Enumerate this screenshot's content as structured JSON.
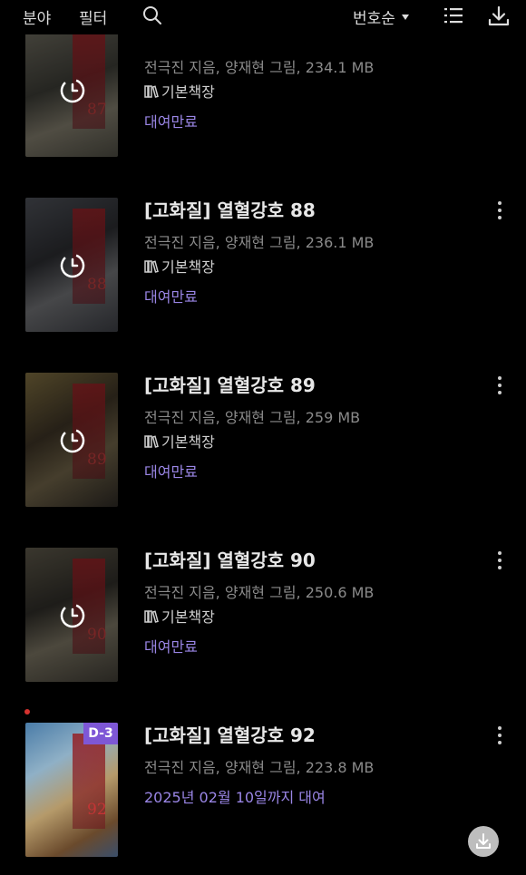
{
  "toolbar": {
    "category_label": "분야",
    "filter_label": "필터",
    "sort_label": "번호순",
    "icons": [
      "search-icon",
      "list-view-icon",
      "download-icon"
    ]
  },
  "books": [
    {
      "title": "",
      "meta": "전극진 지음, 양재현 그림, 234.1 MB",
      "shelf": "기본책장",
      "status": "대여만료",
      "cover_volume": "87",
      "expired": true
    },
    {
      "title": "[고화질] 열혈강호 88",
      "meta": "전극진 지음, 양재현 그림, 236.1 MB",
      "shelf": "기본책장",
      "status": "대여만료",
      "cover_volume": "88",
      "expired": true
    },
    {
      "title": "[고화질] 열혈강호 89",
      "meta": "전극진 지음, 양재현 그림, 259 MB",
      "shelf": "기본책장",
      "status": "대여만료",
      "cover_volume": "89",
      "expired": true
    },
    {
      "title": "[고화질] 열혈강호 90",
      "meta": "전극진 지음, 양재현 그림, 250.6 MB",
      "shelf": "기본책장",
      "status": "대여만료",
      "cover_volume": "90",
      "expired": true
    },
    {
      "title": "[고화질] 열혈강호 92",
      "meta": "전극진 지음, 양재현 그림, 223.8 MB",
      "status": "2025년 02월 10일까지 대여",
      "cover_volume": "92",
      "badge": "D-3",
      "expired": false
    }
  ],
  "colors": {
    "background": "#000000",
    "accent_purple": "#9a86e6",
    "badge_purple": "#7e57d6",
    "new_dot": "#d6322f",
    "meta_gray": "#8a8a8a"
  }
}
